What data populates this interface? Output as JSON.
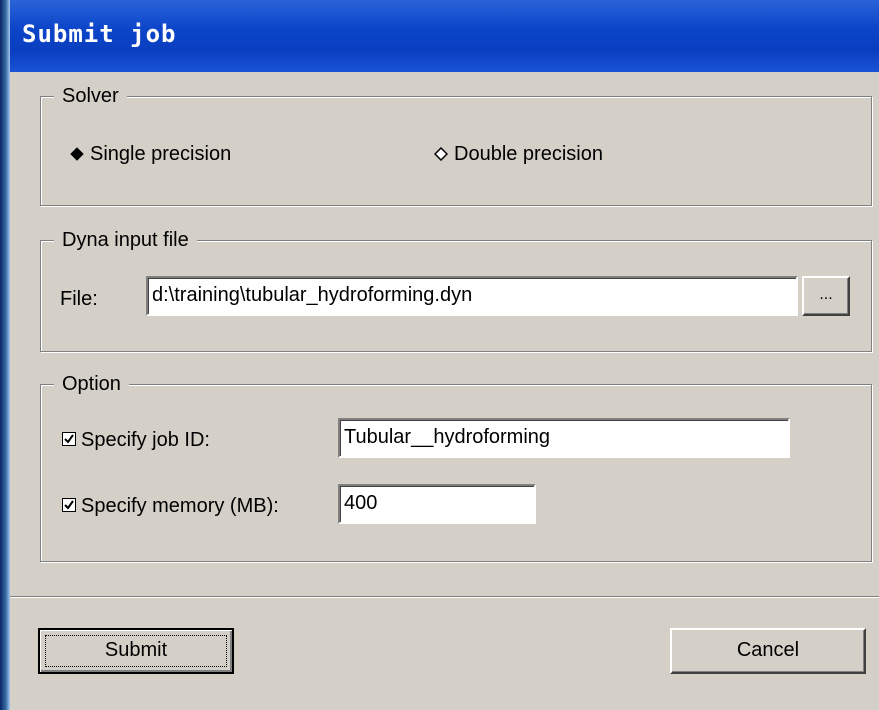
{
  "window": {
    "title": "Submit job"
  },
  "solver": {
    "legend": "Solver",
    "options": [
      {
        "label": "Single precision",
        "selected": true
      },
      {
        "label": "Double precision",
        "selected": false
      }
    ]
  },
  "input_file": {
    "legend": "Dyna input file",
    "file_label": "File:",
    "file_value": "d:\\training\\tubular_hydroforming.dyn",
    "browse_label": "..."
  },
  "option": {
    "legend": "Option",
    "job_id": {
      "label": "Specify job ID:",
      "checked": true,
      "value": "Tubular__hydroforming"
    },
    "memory": {
      "label": "Specify memory (MB):",
      "checked": true,
      "value": "400"
    }
  },
  "buttons": {
    "submit": "Submit",
    "cancel": "Cancel"
  },
  "colors": {
    "title_bar": "#0a3ec0",
    "title_text": "#ffffff",
    "dialog_bg": "#d4d0c8"
  }
}
